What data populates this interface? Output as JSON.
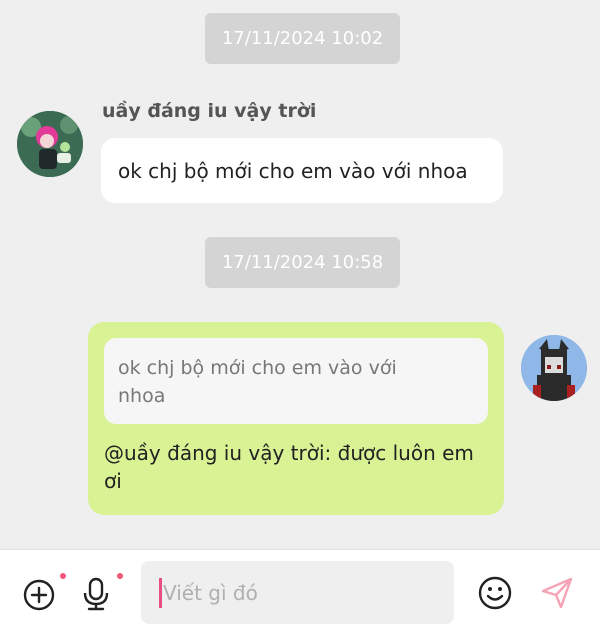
{
  "messages": {
    "timestamp_1": "17/11/2024 10:02",
    "incoming": {
      "sender": "uầy đáng iu vậy trời",
      "text": "ok  chj bộ mới cho em vào với nhoa"
    },
    "timestamp_2": "17/11/2024 10:58",
    "outgoing": {
      "quote_line_1": "ok  chj bộ mới cho em vào với",
      "quote_line_2": "nhoa",
      "reply_line_1": "@uầy đáng iu vậy trời: được luôn em",
      "reply_line_2": "ơi"
    }
  },
  "composer": {
    "placeholder": "Viết gì đó",
    "icons": [
      "add-icon",
      "microphone-icon",
      "emoji-icon",
      "send-icon"
    ]
  },
  "colors": {
    "background": "#efefef",
    "timestamp_bg": "#d4d4d4",
    "outgoing_bubble": "#d8f294",
    "notification_dot": "#f0567a",
    "send_icon": "#f5a3b5"
  }
}
